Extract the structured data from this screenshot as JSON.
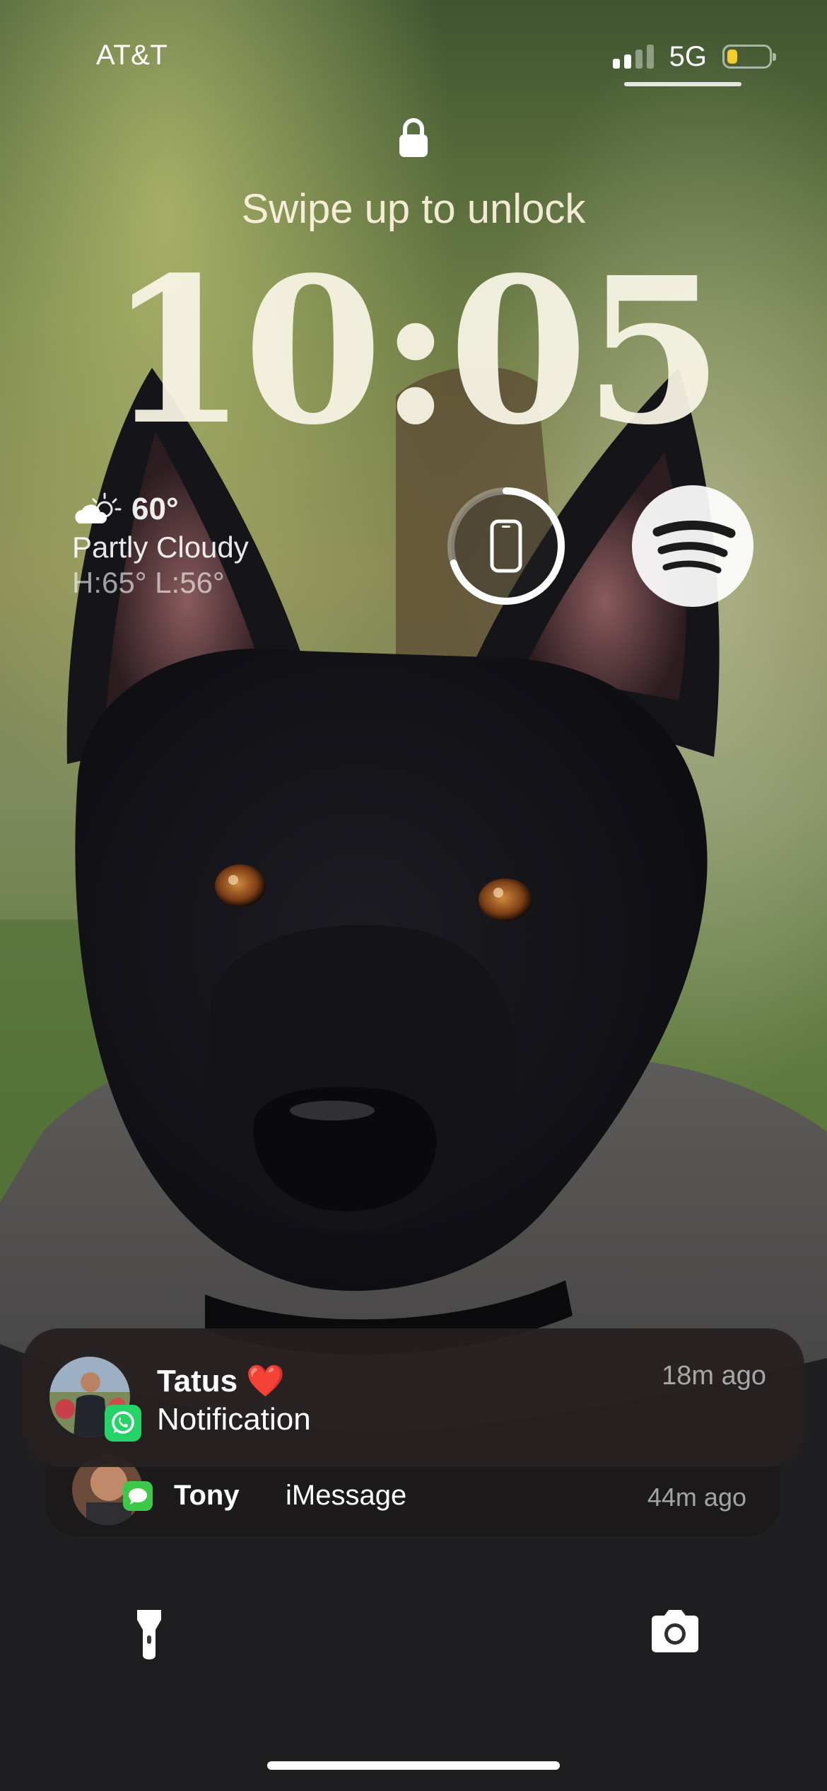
{
  "status_bar": {
    "carrier": "AT&T",
    "network": "5G",
    "signal_bars_active": 2,
    "signal_bars_total": 4,
    "battery_level": 0.25,
    "battery_color": "#f5cc2d"
  },
  "lock_screen": {
    "lock_icon": "lock-icon",
    "swipe_hint": "Swipe up to unlock",
    "time": "10:05"
  },
  "weather": {
    "icon": "partly-cloudy-icon",
    "temperature": "60°",
    "condition": "Partly Cloudy",
    "high_low": "H:65° L:56°"
  },
  "widgets": {
    "battery_widget": {
      "icon": "phone-icon",
      "charge_level": 0.7
    },
    "spotify_widget": {
      "icon": "spotify-icon"
    }
  },
  "notifications": [
    {
      "sender": "Tatus",
      "emoji": "❤️",
      "body": "Notification",
      "time": "18m ago",
      "app_icon": "whatsapp-icon",
      "app_color": "#25d366"
    },
    {
      "sender": "Tony",
      "body": "iMessage",
      "time": "44m ago",
      "app_icon": "messages-icon",
      "app_color": "#3ec84a"
    }
  ],
  "quick_actions": [
    {
      "name": "flashlight",
      "icon": "flashlight-icon"
    },
    {
      "name": "camera",
      "icon": "camera-icon"
    }
  ]
}
